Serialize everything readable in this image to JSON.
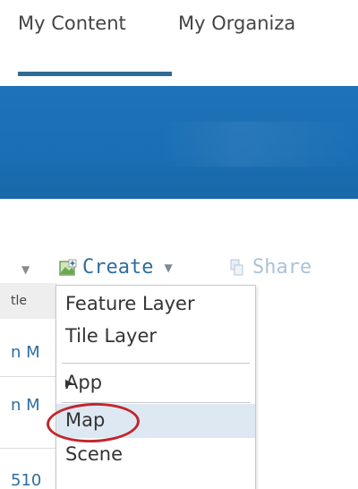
{
  "tabs": [
    {
      "label": "My Content"
    },
    {
      "label": "My Organiza"
    }
  ],
  "toolbar": {
    "create_label": "Create",
    "share_label": "Share"
  },
  "table": {
    "header": "tle",
    "rows": [
      "n M",
      "n M",
      "510"
    ]
  },
  "create_menu": {
    "items": [
      {
        "label": "Feature Layer"
      },
      {
        "label": "Tile Layer"
      },
      {
        "label": "App"
      },
      {
        "label": "Map"
      },
      {
        "label": "Scene"
      }
    ],
    "highlighted": "Map"
  },
  "colors": {
    "tab_underline": "#2e6c96",
    "banner": "#1a6fb4",
    "link": "#2d6ea0",
    "menu_hover": "#dde8f3",
    "annotation": "#c0272d"
  },
  "icons": {
    "create": "create-map-icon",
    "share": "share-icon",
    "submenu": "triangle-right-icon"
  }
}
